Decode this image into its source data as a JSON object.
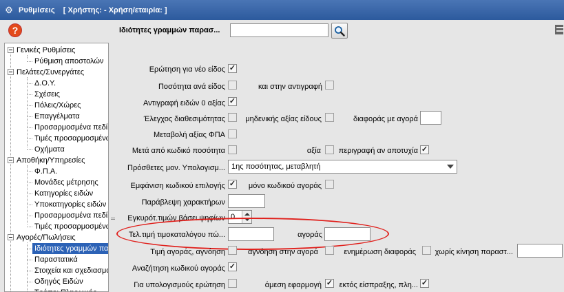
{
  "window": {
    "title": "Ρυθμίσεις",
    "context": "[ Χρήστης: - Χρήση/εταιρία: ]"
  },
  "search": {
    "label": "Ιδιότητες γραμμών παρασ...",
    "value": "",
    "placeholder": ""
  },
  "tree": [
    {
      "label": "Γενικές Ρυθμίσεις",
      "level": 0,
      "toggle": true
    },
    {
      "label": "Ρύθμιση αποστολών",
      "level": 1
    },
    {
      "label": "Πελάτες/Συνεργάτες",
      "level": 0,
      "toggle": true
    },
    {
      "label": "Δ.Ο.Υ.",
      "level": 1
    },
    {
      "label": "Σχέσεις",
      "level": 1
    },
    {
      "label": "Πόλεις/Χώρες",
      "level": 1
    },
    {
      "label": "Επαγγέλματα",
      "level": 1
    },
    {
      "label": "Προσαρμοσμένα πεδί",
      "level": 1
    },
    {
      "label": "Τιμές προσαρμοσμένω",
      "level": 1
    },
    {
      "label": "Οχήματα",
      "level": 1
    },
    {
      "label": "Αποθήκη/Υπηρεσίες",
      "level": 0,
      "toggle": true
    },
    {
      "label": "Φ.Π.Α.",
      "level": 1
    },
    {
      "label": "Μονάδες μέτρησης",
      "level": 1
    },
    {
      "label": "Κατηγορίες ειδών",
      "level": 1
    },
    {
      "label": "Υποκατηγορίες ειδών",
      "level": 1
    },
    {
      "label": "Προσαρμοσμένα πεδί",
      "level": 1
    },
    {
      "label": "Τιμές προσαρμοσμένω",
      "level": 1
    },
    {
      "label": "Αγορές/Πωλήσεις",
      "level": 0,
      "toggle": true
    },
    {
      "label": "Ιδιότητες γραμμών πα",
      "level": 1,
      "selected": true
    },
    {
      "label": "Παραστατικά",
      "level": 1
    },
    {
      "label": "Στοιχεία και σχεδιασμό",
      "level": 1
    },
    {
      "label": "Οδηγός Ειδών",
      "level": 1
    },
    {
      "label": "Τρόποι Πληρωμής",
      "level": 1
    }
  ],
  "form": {
    "ask_new_item": "Ερώτηση για νέο είδος",
    "qty_per_item": "Ποσότητα ανά είδος",
    "also_copy": "και στην αντιγραφή",
    "copy_zero": "Αντιγραφή ειδών 0 αξίας",
    "check_avail": "Έλεγχος διαθεσιμότητας",
    "zero_value": "μηδενικής αξίας είδους",
    "diff_purchase": "διαφοράς με αγορά",
    "vat_change": "Μεταβολή αξίας ΦΠΑ",
    "after_code": "Μετά από κωδικό ποσότητα",
    "value": "αξία",
    "description_fail": "περιγραφή αν αποτυχία",
    "extra_units": "Πρόσθετες μον. Υπολογισμ...",
    "extra_units_value": "1ης ποσότητας, μεταβλητή",
    "show_code": "Εμφάνιση κωδικού επιλογής",
    "only_purchase_code": "μόνο κωδικού αγοράς",
    "skip_chars": "Παράβλεψη χαρακτήρων",
    "valid_price": "Εγκυρότ.τιμών βάσει ψηφίων",
    "valid_price_value": "0",
    "last_price": "Τελ.τιμή τιμοκαταλόγου πώ...",
    "purchase": "αγοράς",
    "price_purchase": "Τιμή αγοράς, αγνόηση",
    "ignore_purchase": "αγνόηση στην αγορά",
    "update_diff": "ενημέρωση διαφοράς",
    "no_movement": "χωρίς κίνηση παραστ...",
    "search_purchase_code": "Αναζήτηση κωδικού αγοράς",
    "for_calc": "Για υπολογισμούς ερώτηση",
    "immediate": "άμεση εφαρμογή",
    "except_collect": "εκτός είσπραξης, πλη..."
  }
}
